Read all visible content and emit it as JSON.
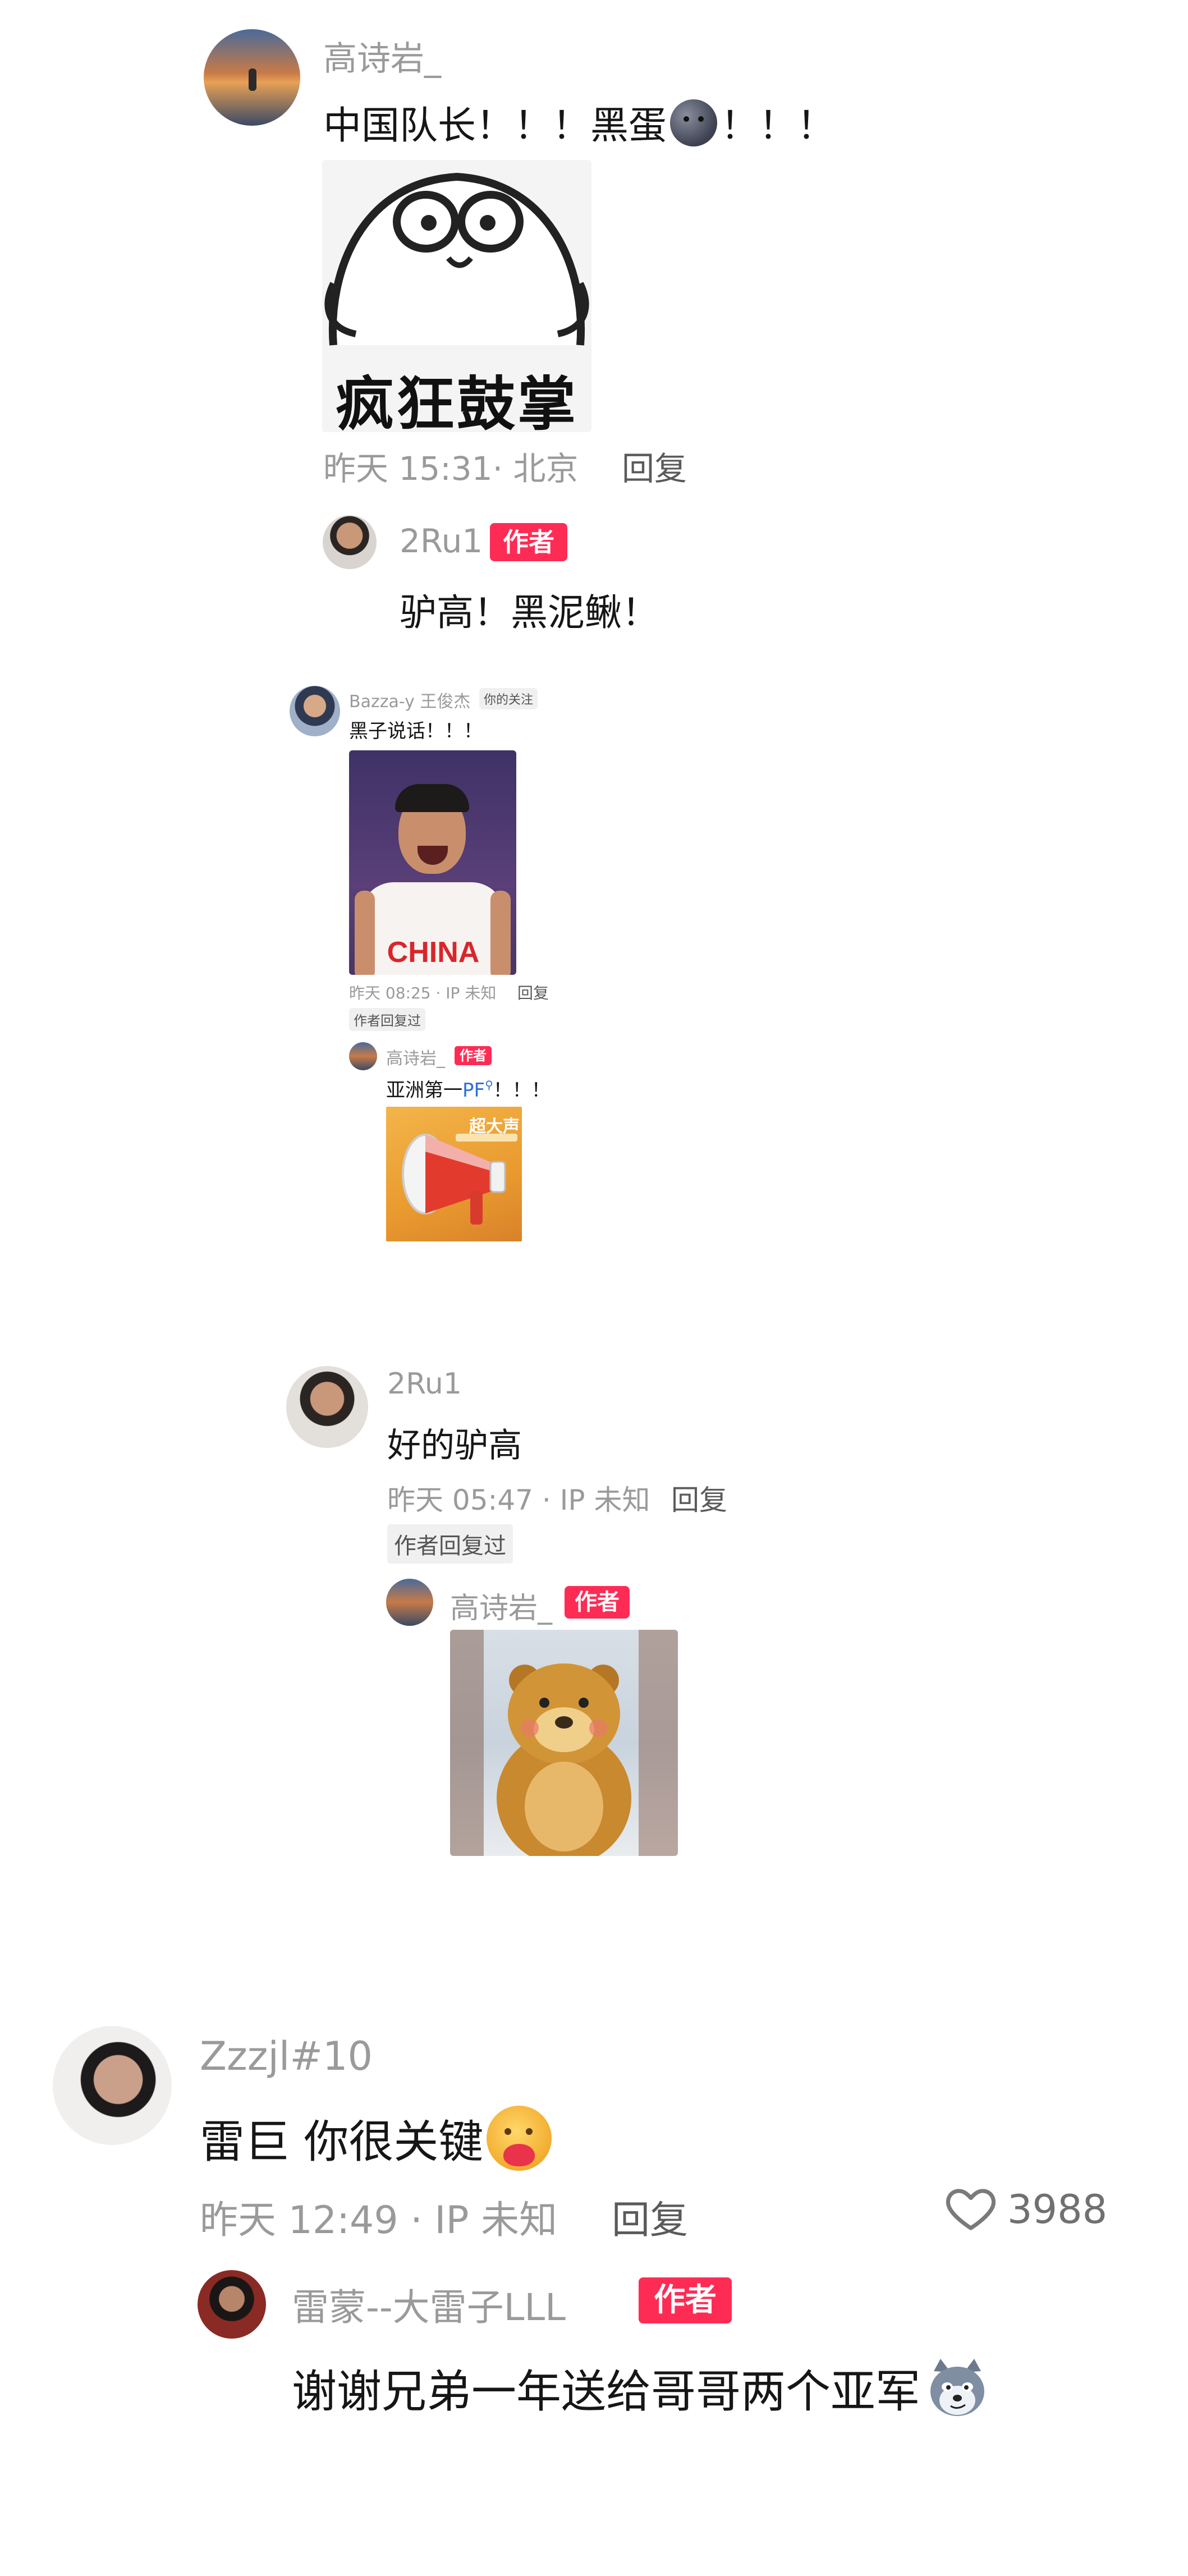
{
  "thread": {
    "c1_name": "高诗岩_",
    "c1_text": "中国队长！！！黑蛋",
    "c1_suffix": "！！！",
    "c1_sticker": "疯狂鼓掌",
    "c1_time": "昨天 15:31· 北京",
    "c1_reply": "回复",
    "r1_name": "2Ru1",
    "r1_badge": "作者",
    "r1_text": "驴高！黑泥鳅！",
    "q_name": "Bazza-y 王俊杰",
    "q_follow": "你的关注",
    "q_text": "黑子说话！！！",
    "q_jersey": "CHINA",
    "q_time": "昨天 08:25 · IP 未知",
    "q_reply": "回复",
    "q_author_replied": "作者回复过",
    "q_sub_name": "高诗岩_",
    "q_sub_badge": "作者",
    "q_sub_text": "亚洲第一",
    "q_sub_link": "PF",
    "q_sub_text2": "！！！",
    "q_sub_img_label": "超大声",
    "c2_name": "2Ru1",
    "c2_text": "好的驴高",
    "c2_time": "昨天 05:47 · IP 未知",
    "c2_reply": "回复",
    "c2_author_replied": "作者回复过",
    "c2_sub_name": "高诗岩_",
    "c2_sub_badge": "作者",
    "c3_name": "Zzzjl#10",
    "c3_text": "雷巨 你很关键",
    "c3_time": "昨天 12:49 · IP 未知",
    "c3_reply": "回复",
    "c3_likes": "3988",
    "c3_sub_name": "雷蒙--大雷子LLL",
    "c3_sub_badge": "作者",
    "c3_sub_text": "谢谢兄弟一年送给哥哥两个亚军"
  },
  "icons": [
    "heart-icon",
    "search-icon",
    "dark-moon-emoji-icon",
    "hug-emoji-icon",
    "wolf-emoji-icon"
  ],
  "colors": {
    "badge": "#fe2c55",
    "meta": "#9a9a9a",
    "link": "#2f6fd6"
  }
}
